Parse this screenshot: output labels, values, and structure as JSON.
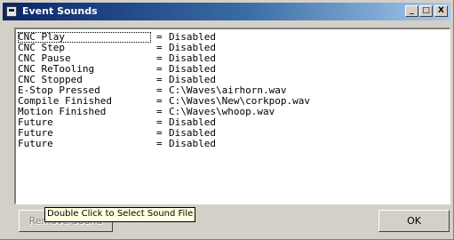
{
  "window": {
    "title": "Event Sounds",
    "min_label": "_",
    "max_label": "□",
    "close_label": "X"
  },
  "events": [
    {
      "name": "CNC Play",
      "eq": "=",
      "value": "Disabled"
    },
    {
      "name": "CNC Step",
      "eq": "=",
      "value": "Disabled"
    },
    {
      "name": "CNC Pause",
      "eq": "=",
      "value": "Disabled"
    },
    {
      "name": "CNC ReTooling",
      "eq": "=",
      "value": "Disabled"
    },
    {
      "name": "CNC Stopped",
      "eq": "=",
      "value": "Disabled"
    },
    {
      "name": "E-Stop Pressed",
      "eq": "=",
      "value": "C:\\Waves\\airhorn.wav"
    },
    {
      "name": "Compile Finished",
      "eq": "=",
      "value": "C:\\Waves\\New\\corkpop.wav"
    },
    {
      "name": "Motion Finished",
      "eq": "=",
      "value": "C:\\Waves\\whoop.wav"
    },
    {
      "name": "Future",
      "eq": "=",
      "value": "Disabled"
    },
    {
      "name": "Future",
      "eq": "=",
      "value": "Disabled"
    },
    {
      "name": "Future",
      "eq": "=",
      "value": "Disabled"
    }
  ],
  "buttons": {
    "remove_label": "Remove Sound",
    "ok_label": "OK"
  },
  "tooltip": "Double Click to Select Sound File"
}
